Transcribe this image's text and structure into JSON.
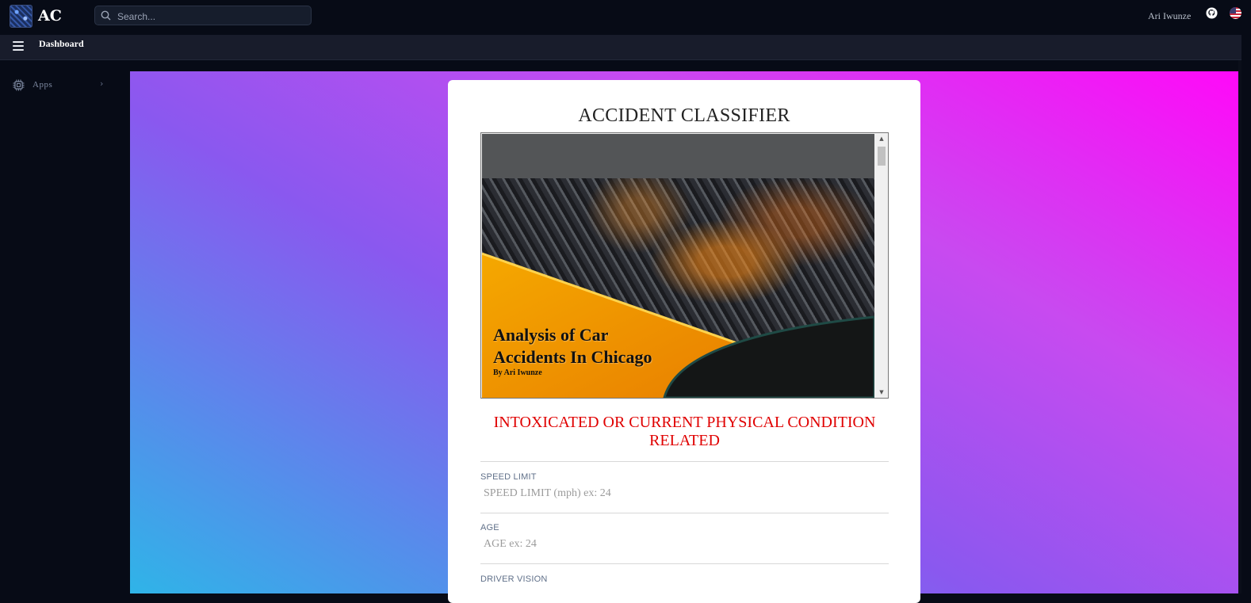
{
  "header": {
    "brand": "AC",
    "search_placeholder": "Search...",
    "user_name": "Ari Iwunze"
  },
  "subbar": {
    "breadcrumb": "Dashboard"
  },
  "sidebar": {
    "items": [
      {
        "label": "Apps",
        "icon": "chip-icon"
      }
    ]
  },
  "card": {
    "title": "ACCIDENT CLASSIFIER",
    "slide": {
      "title_line1": "Analysis of Car",
      "title_line2": "Accidents In Chicago",
      "byline": "By Ari Iwunze"
    },
    "result": "INTOXICATED OR CURRENT PHYSICAL CONDITION RELATED",
    "fields": [
      {
        "label": "SPEED LIMIT",
        "placeholder": "SPEED LIMIT (mph) ex: 24"
      },
      {
        "label": "AGE",
        "placeholder": "AGE ex: 24"
      },
      {
        "label": "DRIVER VISION",
        "placeholder": ""
      }
    ]
  },
  "colors": {
    "result_text": "#e00000",
    "gradient_start": "#2fb4e8",
    "gradient_mid": "#8a58ef",
    "gradient_end": "#ff09f8",
    "slide_accent": "#f5a300"
  }
}
